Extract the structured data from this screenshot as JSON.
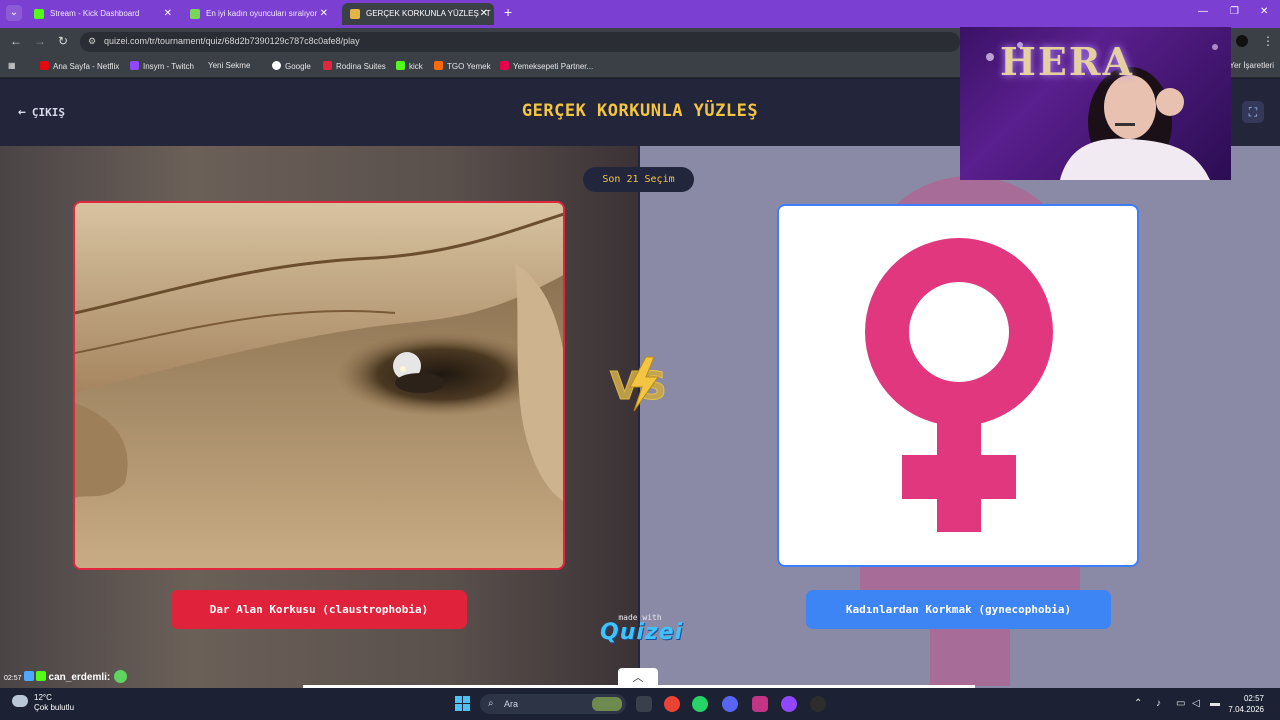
{
  "browser": {
    "tabs": [
      {
        "label": "Stream - Kick Dashboard",
        "favicon_color": "#53fc18",
        "active": false
      },
      {
        "label": "En iyi kadın oyuncuları sıralıyor",
        "favicon_color": "#7ad35b",
        "active": false
      },
      {
        "label": "GERÇEK KORKUNLA YÜZLEŞ - T",
        "favicon_color": "#e2b547",
        "active": true
      }
    ],
    "new_tab_symbol": "+",
    "url": "quizei.com/tr/tournament/quiz/68d2b7390129c787c8c0afe8/play",
    "bookmarks": [
      {
        "label": "Ana Sayfa - Netflix",
        "color": "#e50914"
      },
      {
        "label": "Insym - Twitch",
        "color": "#9146ff"
      },
      {
        "label": "Yeni Sekme",
        "color": "#3b3f46"
      },
      {
        "label": "Google",
        "color": "#ffffff"
      },
      {
        "label": "Rodina Suites",
        "color": "#e2263d"
      },
      {
        "label": "kick",
        "color": "#53fc18"
      },
      {
        "label": "TGO Yemek",
        "color": "#ff6a00"
      },
      {
        "label": "Yemeksepeti Partner...",
        "color": "#ea004b"
      }
    ],
    "bookmarks_right": "Yer İşaretleri"
  },
  "page": {
    "exit_label": "ÇIKIŞ",
    "title": "GERÇEK KORKUNLA YÜZLEŞ",
    "round_label": "Son 21 Seçim",
    "vs_label": "VS",
    "option_left": "Dar Alan Korkusu (claustrophobia)",
    "option_right": "Kadınlardan Korkmak (gynecophobia)",
    "made_with": "made with",
    "brand": "QUIZEI",
    "accent_yellow": "#f4c542",
    "left_color": "#e0223b",
    "right_color": "#3d84f5",
    "venus_color": "#e0377f"
  },
  "chat": {
    "time": "02:57",
    "user": "can_erdemli",
    "separator": ":"
  },
  "webcam": {
    "overlay_text": "HERA"
  },
  "taskbar": {
    "temperature": "12°C",
    "weather": "Çok bulutlu",
    "search_placeholder": "Ara",
    "time": "02:57",
    "date": "7.04.2026"
  }
}
